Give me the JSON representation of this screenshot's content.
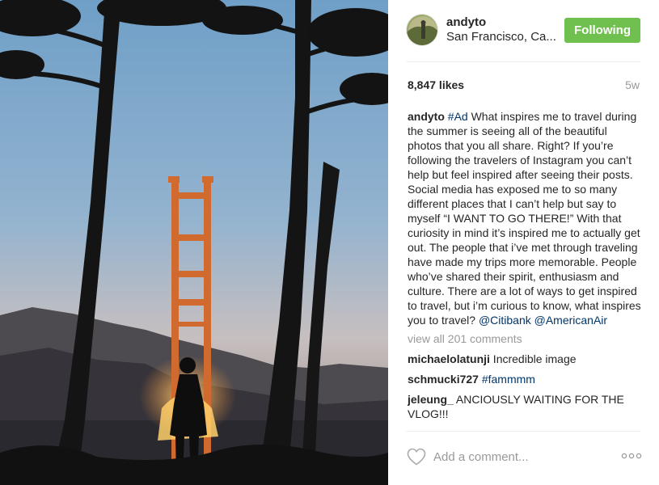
{
  "post": {
    "username": "andyto",
    "location": "San Francisco, Ca...",
    "follow_label": "Following",
    "likes": "8,847 likes",
    "time": "5w",
    "caption": {
      "username": "andyto",
      "hashtag": "#Ad",
      "text": " What inspires me to travel during the summer is seeing all of the beautiful photos that you all share. Right? If you’re following the travelers of Instagram you can’t help but feel inspired after seeing their posts. Social media has exposed me to so many different places that I can’t help but say to myself “I WANT TO GO THERE!” With that curiosity in mind it’s inspired me to actually get out. The people that i’ve met through traveling have made my trips more memorable. People who’ve shared their spirit, enthusiasm and culture. There are a lot of ways to get inspired to travel, but i’m curious to know, what inspires you to travel? ",
      "mention1": "@Citibank",
      "mention2": "@AmericanAir"
    },
    "view_all": "view all 201 comments",
    "comments": [
      {
        "username": "michaelolatunji",
        "text": " Incredible image",
        "tag": ""
      },
      {
        "username": "schmucki727",
        "text": " ",
        "tag": "#fammmm"
      },
      {
        "username": "jeleung_",
        "text": " ANCIOUSLY WAITING FOR THE VLOG!!!",
        "tag": ""
      }
    ],
    "add_comment_placeholder": "Add a comment..."
  },
  "icons": {
    "heart": "heart-icon",
    "more": "more-options-icon"
  },
  "colors": {
    "follow_green": "#70c050",
    "hashtag_blue": "#003569",
    "muted_grey": "#999999"
  }
}
